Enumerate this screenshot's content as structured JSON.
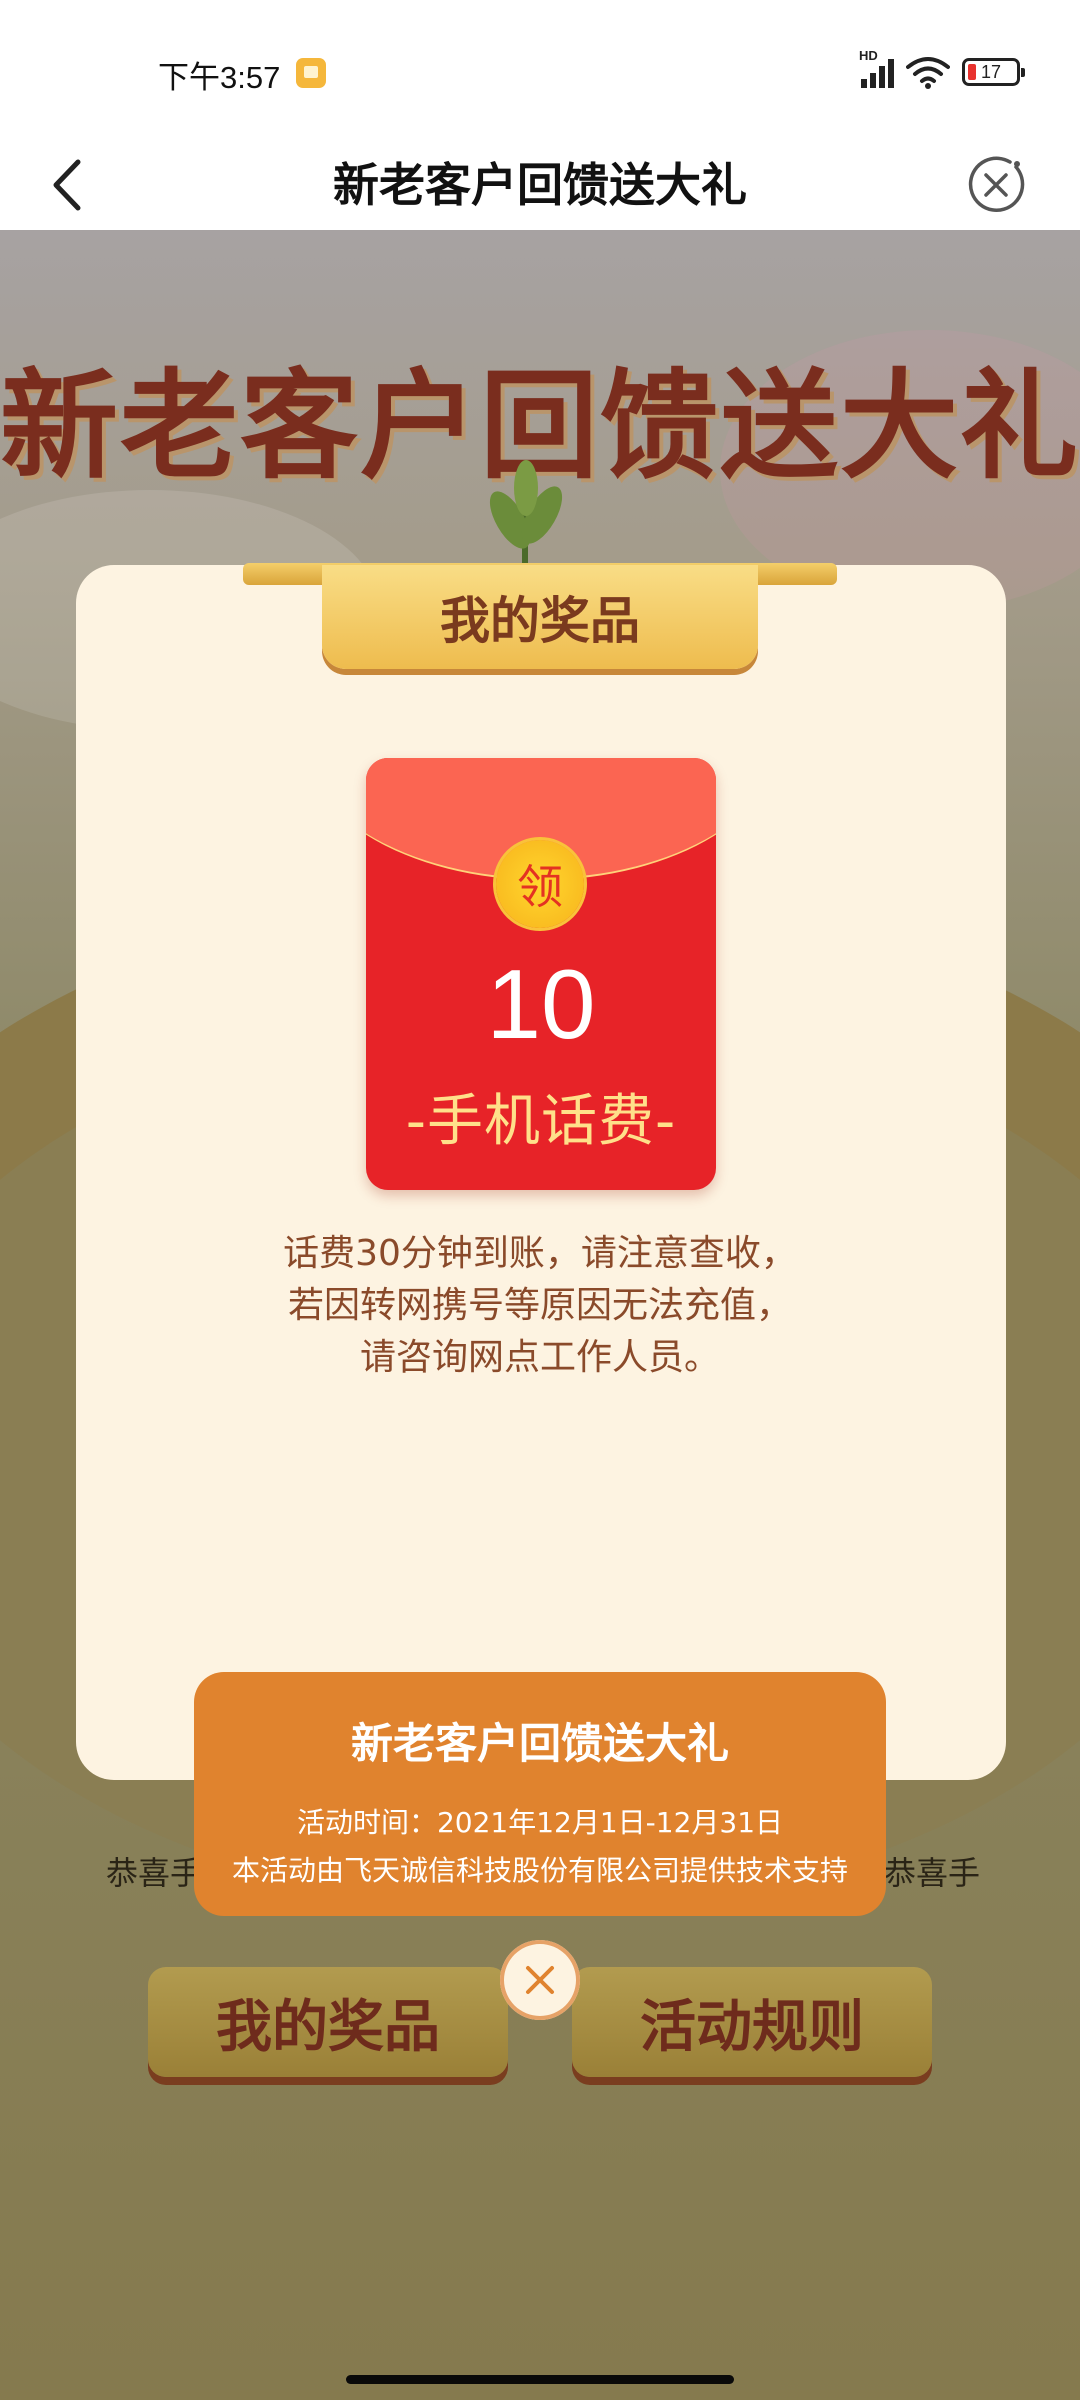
{
  "status_bar": {
    "time": "下午3:57",
    "network": "HD",
    "battery": "17",
    "icons": [
      "notification-icon",
      "signal-icon",
      "wifi-icon",
      "battery-icon"
    ]
  },
  "nav": {
    "title": "新老客户回馈送大礼",
    "back_icon": "chevron-left-icon",
    "close_icon": "close-circle-icon"
  },
  "background": {
    "banner_title": "新老客户回馈送大礼",
    "scroll_left": "恭喜手",
    "scroll_right": "恭喜手",
    "buttons": [
      "我的奖品",
      "活动规则"
    ]
  },
  "modal": {
    "heading": "我的奖品",
    "envelope": {
      "seal": "领",
      "amount": "10",
      "label": "-手机话费-"
    },
    "note_lines": [
      "话费30分钟到账，请注意查收，",
      "若因转网携号等原因无法充值，",
      "请咨询网点工作人员。"
    ]
  },
  "info_panel": {
    "title": "新老客户回馈送大礼",
    "time": "活动时间：2021年12月1日-12月31日",
    "support": "本活动由飞天诚信科技股份有限公司提供技术支持"
  },
  "colors": {
    "envelope_red": "#e72328",
    "info_orange": "#e0832e",
    "card_cream": "#fdf3e1",
    "gold": "#f4cf6a",
    "brown_text": "#7a2d1e"
  }
}
